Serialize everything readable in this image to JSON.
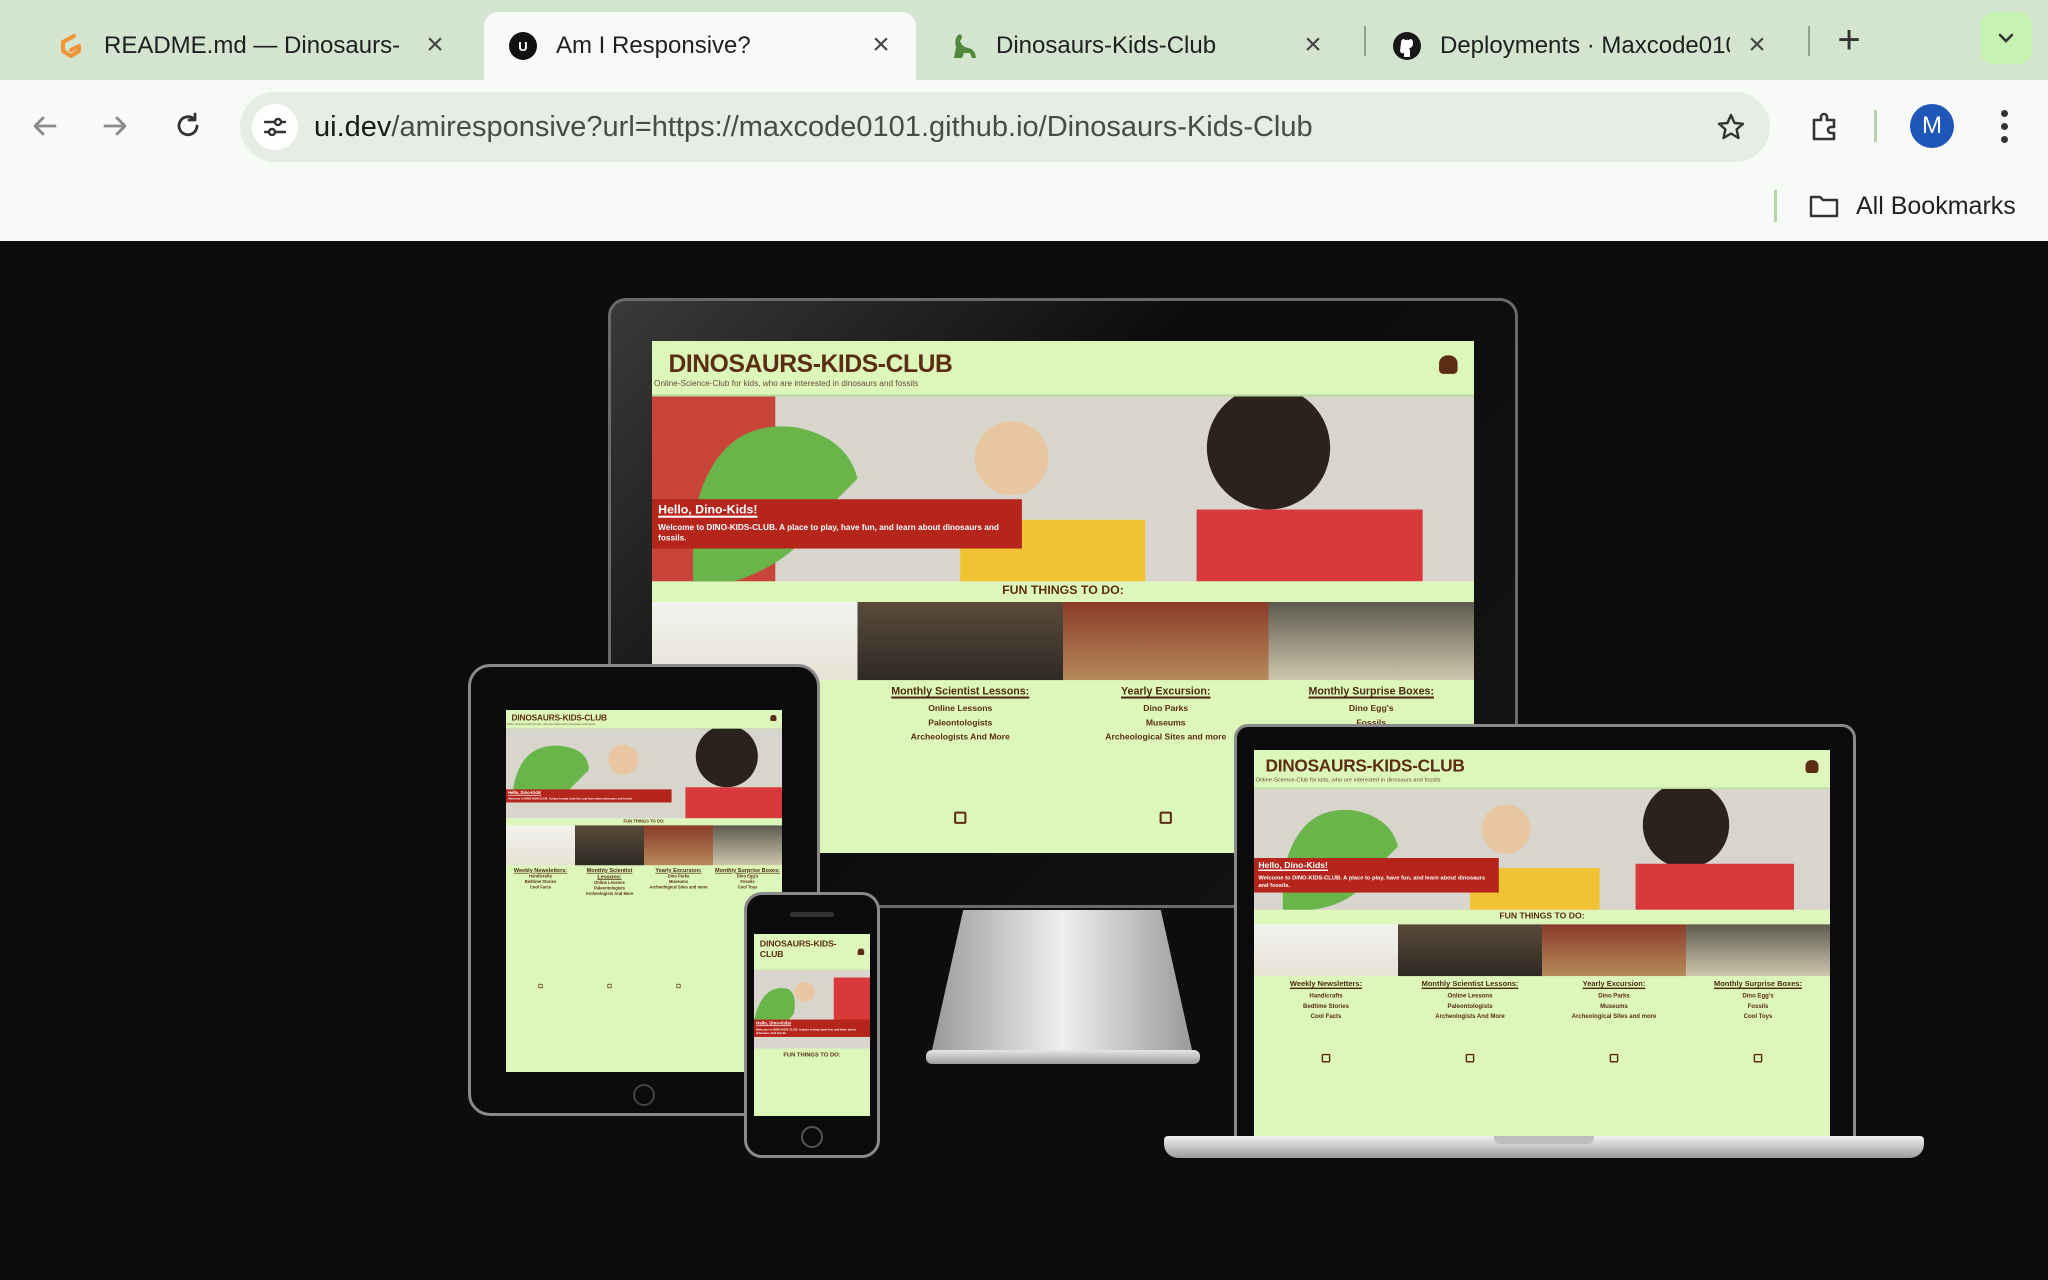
{
  "tabs": [
    {
      "title": "README.md — Dinosaurs-",
      "favicon": "gitpod-logo-icon",
      "active": false
    },
    {
      "title": "Am I Responsive?",
      "favicon": "ui-dev-logo-icon",
      "active": true
    },
    {
      "title": "Dinosaurs-Kids-Club",
      "favicon": "dinosaur-icon",
      "active": false
    },
    {
      "title": "Deployments · Maxcode010",
      "favicon": "github-icon",
      "active": false
    }
  ],
  "address": {
    "host": "ui.dev",
    "path": "/amiresponsive?url=https://maxcode0101.github.io/Dinosaurs-Kids-Club"
  },
  "profile": {
    "initial": "M"
  },
  "bookmarks": {
    "all_label": "All Bookmarks"
  },
  "site": {
    "brand": "DINOSAURS-KIDS-CLUB",
    "brand_wrapped_1": "DINOSAURS-KIDS-",
    "brand_wrapped_2": "CLUB",
    "tagline": "Online-Science-Club for kids, who are interested in dinosaurs and fossils",
    "hero_heading": "Hello, Dino-Kids!",
    "hero_text": "Welcome to DINO-KIDS-CLUB. A place to play, have fun, and learn about dinosaurs and fossils.",
    "fun_heading": "FUN THINGS TO DO:",
    "cards": [
      {
        "title": "Weekly Newsletters:",
        "items": [
          "Handicrafts",
          "Bedtime Stories",
          "Cool Facts"
        ]
      },
      {
        "title": "Monthly Scientist Lessons:",
        "items": [
          "Online Lessons",
          "Paleontologists",
          "Archeologists And More"
        ]
      },
      {
        "title": "Yearly Excursion:",
        "items": [
          "Dino Parks",
          "Museums",
          "Archeological Sites and more"
        ]
      },
      {
        "title": "Monthly Surprise Boxes:",
        "items": [
          "Dino Egg's",
          "Fossils",
          "Cool Toys"
        ]
      }
    ]
  },
  "colors": {
    "page_bg": "#0d0d0d",
    "site_bg": "#ddf7bb",
    "banner_red": "#b5251b",
    "brand_brown": "#5a2d14"
  }
}
